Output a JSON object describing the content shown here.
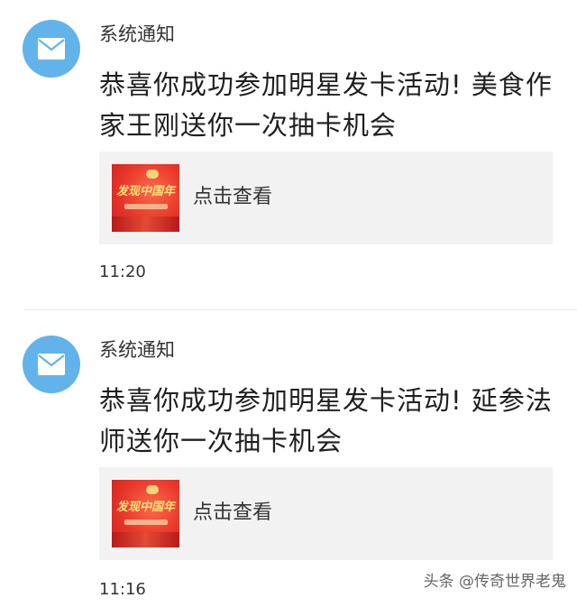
{
  "messages": [
    {
      "sender": "系统通知",
      "text": "恭喜你成功参加明星发卡活动! 美食作家王刚送你一次抽卡机会",
      "card": {
        "thumb_title": "发现中国年",
        "label": "点击查看"
      },
      "time": "11:20"
    },
    {
      "sender": "系统通知",
      "text": "恭喜你成功参加明星发卡活动! 延参法师送你一次抽卡机会",
      "card": {
        "thumb_title": "发现中国年",
        "label": "点击查看"
      },
      "time": "11:16"
    }
  ],
  "watermark": "头条 @传奇世界老鬼",
  "colors": {
    "avatar": "#62b3ea",
    "card_bg": "#f2f2f2",
    "thumb_red": "#e8352a"
  },
  "icons": {
    "avatar": "envelope-icon"
  }
}
